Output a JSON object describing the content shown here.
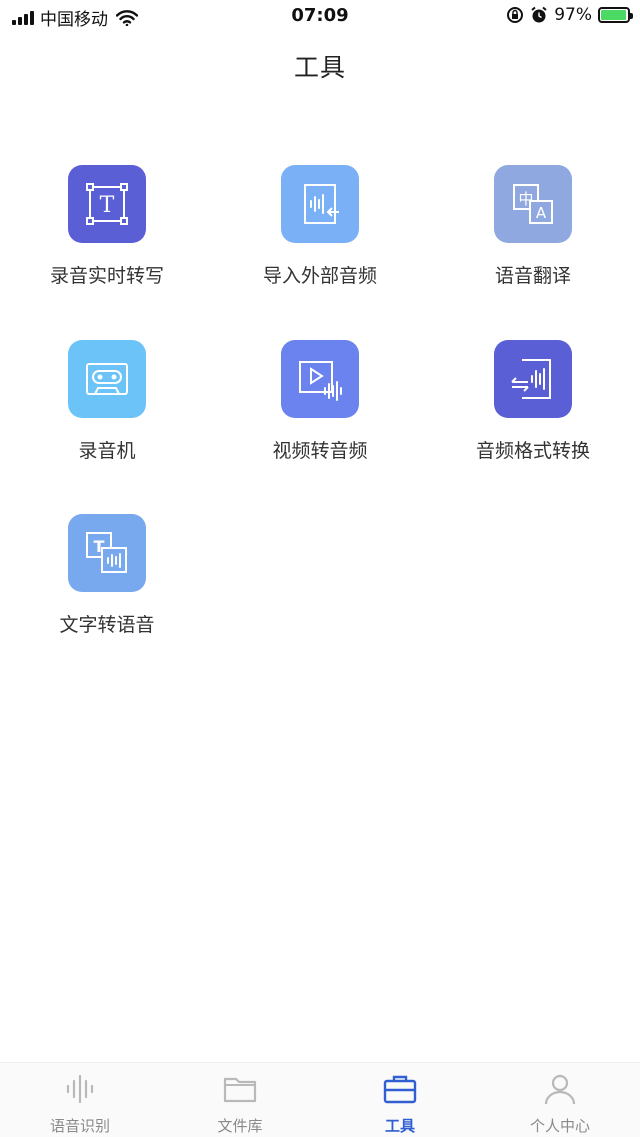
{
  "status_bar": {
    "carrier": "中国移动",
    "time": "07:09",
    "battery": "97%",
    "battery_level": 0.97
  },
  "header": {
    "title": "工具"
  },
  "tools": [
    {
      "label": "录音实时转写",
      "icon": "text-frame-icon",
      "color": "#5b5fd6"
    },
    {
      "label": "导入外部音频",
      "icon": "import-audio-icon",
      "color": "#7ab0f5"
    },
    {
      "label": "语音翻译",
      "icon": "translate-icon",
      "color": "#8fa9e0"
    },
    {
      "label": "录音机",
      "icon": "cassette-icon",
      "color": "#6cc3f7"
    },
    {
      "label": "视频转音频",
      "icon": "video-to-audio-icon",
      "color": "#6a83ee"
    },
    {
      "label": "音频格式转换",
      "icon": "audio-convert-icon",
      "color": "#5b5fd6"
    },
    {
      "label": "文字转语音",
      "icon": "text-to-speech-icon",
      "color": "#78a8ee"
    }
  ],
  "tab_bar": {
    "tabs": [
      {
        "label": "语音识别",
        "icon": "waveform-icon",
        "active": false
      },
      {
        "label": "文件库",
        "icon": "folder-icon",
        "active": false
      },
      {
        "label": "工具",
        "icon": "toolbox-icon",
        "active": true
      },
      {
        "label": "个人中心",
        "icon": "user-icon",
        "active": false
      }
    ],
    "active_color": "#2f5fd0",
    "inactive_color": "#b9b9b9"
  }
}
